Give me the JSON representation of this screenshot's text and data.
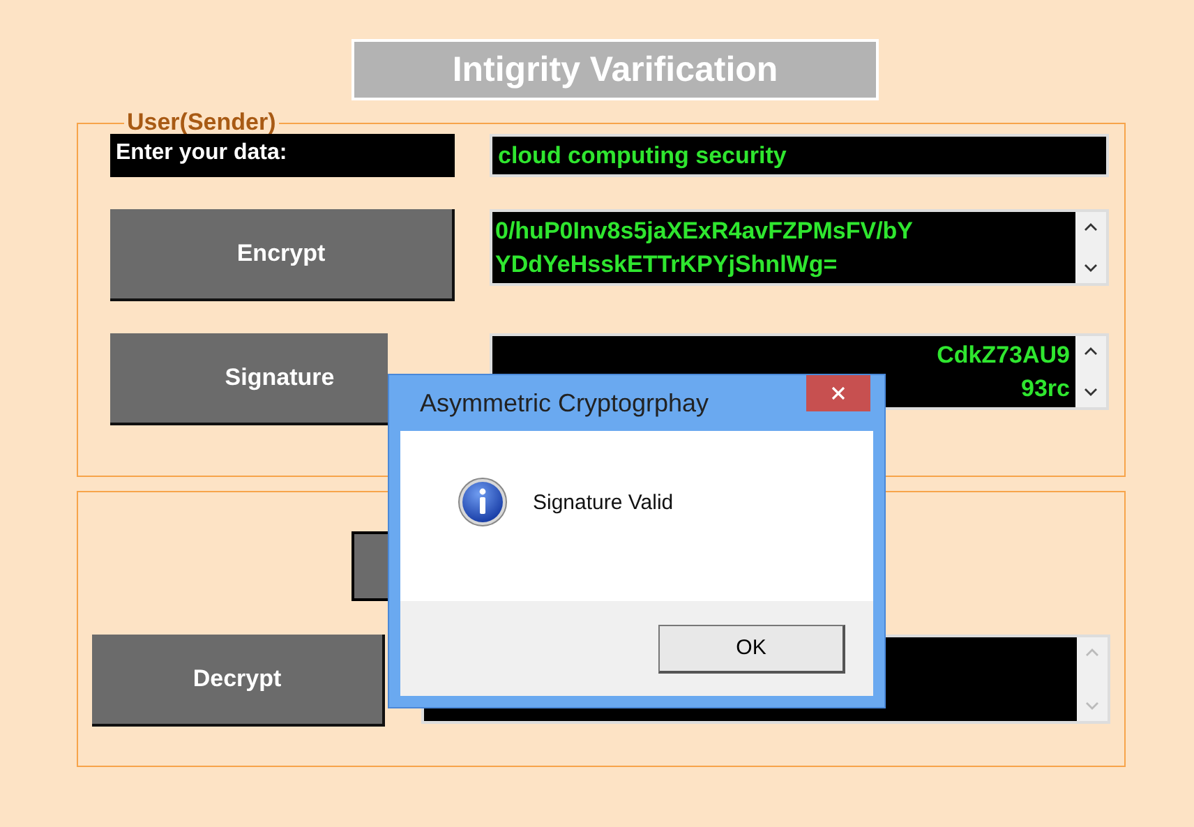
{
  "title": "Intigrity Varification",
  "sender": {
    "legend": "User(Sender)",
    "input_label": "Enter your data:",
    "input_value": "cloud computing security",
    "rows": [
      {
        "button": "Encrypt",
        "lines": [
          "0/huP0Inv8s5jaXExR4avFZPMsFV/bY",
          "YDdYeHsskETTrKPYjShnlWg="
        ],
        "scroll_enabled": true
      },
      {
        "button": "Signature",
        "lines": [
          "CdkZ73AU9",
          "93rc"
        ],
        "scroll_enabled": true
      }
    ]
  },
  "receiver": {
    "decrypt_button": "Decrypt",
    "scroll_enabled": false
  },
  "dialog": {
    "title": "Asymmetric Cryptogrphay",
    "message": "Signature Valid",
    "ok": "OK"
  }
}
